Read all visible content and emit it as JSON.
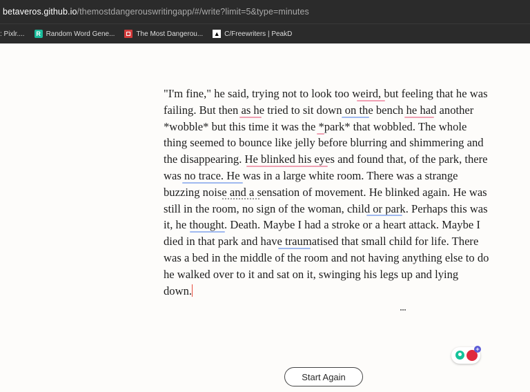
{
  "browser": {
    "url_host": "betaveros.github.io",
    "url_path": "/themostdangerouswritingapp/#/write?limit=5&type=minutes",
    "bookmarks": [
      {
        "label": ": Pixlr....",
        "icon": "none"
      },
      {
        "label": "Random Word Gene...",
        "icon": "r-icon"
      },
      {
        "label": "The Most Dangerou...",
        "icon": "red-square-icon"
      },
      {
        "label": "C/Freewriters | PeakD",
        "icon": "a-icon"
      }
    ]
  },
  "essay": {
    "text": "\"I'm fine,\" he said, trying not to look too weird, but feeling that he was failing. But then as he tried to sit down on the bench he had another *wobble* but this time it was the *park* that wobbled. The whole thing seemed to bounce like jelly before blurring and shimmering and the disappearing. He blinked his eyes and found that, of the park, there was no trace. He was in a large white room. There was a strange buzzing noise and a sensation of movement. He blinked again. He was still in the room, no sign of the woman, child or park. Perhaps this was it, he thought. Death. Maybe I had a stroke or a heart attack. Maybe I died in that park and have traumatised that small child for life. There was a bed in the middle of the room and not having anything else to do he walked over to it and sat on it, swinging his legs up and lying down."
  },
  "colors": {
    "spelling_underline": "#f0a0b3",
    "grammar_underline": "#9fb9f0",
    "cursor": "#e74c3c"
  },
  "actions": {
    "start_again": "Start Again"
  }
}
